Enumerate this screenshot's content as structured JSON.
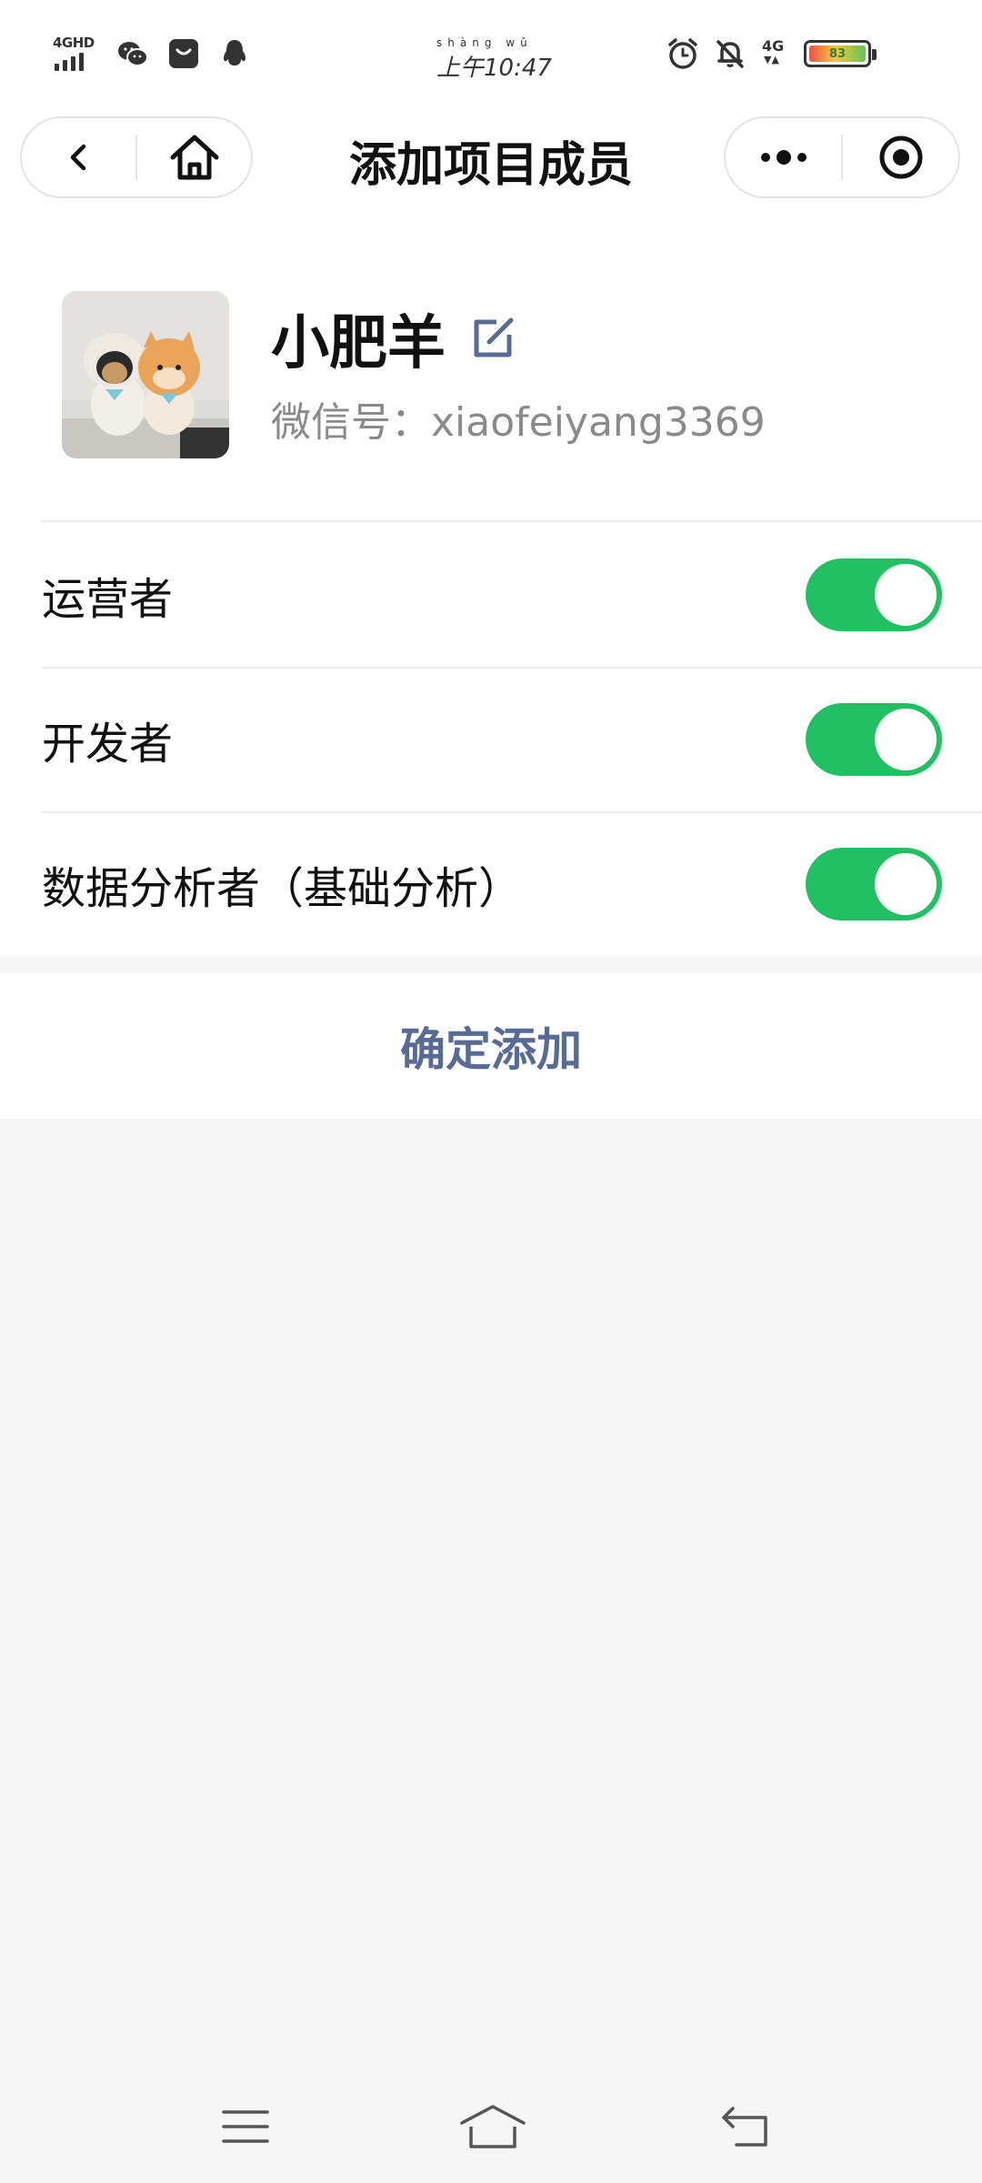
{
  "status_bar": {
    "network_label": "4GHD",
    "time_pinyin": "shàng wǔ",
    "time": "上午10:47",
    "cell_label": "4G",
    "battery_level": "83"
  },
  "nav": {
    "title": "添加项目成员"
  },
  "profile": {
    "nickname": "小肥羊",
    "wechat_id": "微信号：xiaofeiyang3369"
  },
  "roles": [
    {
      "label": "运营者",
      "enabled": true
    },
    {
      "label": "开发者",
      "enabled": true
    },
    {
      "label": "数据分析者（基础分析）",
      "enabled": true
    }
  ],
  "confirm_label": "确定添加",
  "colors": {
    "accent_green": "#21c063",
    "link_blue": "#576b95",
    "background": "#f6f6f6"
  },
  "icons": [
    "back-icon",
    "home-icon",
    "more-icon",
    "close-miniprogram-icon",
    "edit-icon",
    "menu-icon",
    "system-home-icon",
    "system-back-icon"
  ]
}
